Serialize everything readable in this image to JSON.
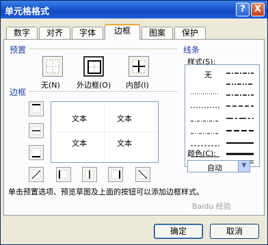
{
  "window": {
    "title": "单元格格式",
    "help": "?",
    "close": "X"
  },
  "tabs": [
    "数字",
    "对齐",
    "字体",
    "边框",
    "图案",
    "保护"
  ],
  "active_tab": "边框",
  "sections": {
    "preset": "预置",
    "border": "边框",
    "line": "线条"
  },
  "presets": [
    {
      "label": "无(N)",
      "icon": "no-border-icon"
    },
    {
      "label": "外边框(O)",
      "icon": "outline-border-icon"
    },
    {
      "label": "内部(I)",
      "icon": "inside-border-icon"
    }
  ],
  "preview": {
    "texts": [
      "文本",
      "文本",
      "文本",
      "文本"
    ]
  },
  "line": {
    "style_label": "样式(S):",
    "none": "无",
    "color_label": "颜色(C):",
    "color_value": "自动"
  },
  "hint": "单击预置选项、预览草图及上面的按钮可以添加边框样式。",
  "buttons": {
    "ok": "确定",
    "cancel": "取消"
  },
  "watermark": "Baidu 经验"
}
